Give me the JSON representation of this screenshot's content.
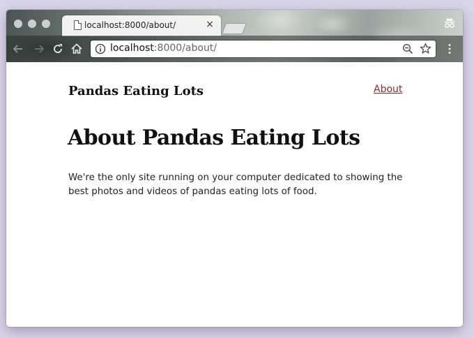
{
  "browser": {
    "tab": {
      "title": "localhost:8000/about/",
      "close_glyph": "×",
      "icon": "document-icon"
    },
    "omnibox": {
      "url_host": "localhost",
      "url_rest": ":8000/about/",
      "info_icon": "info-icon",
      "zoom_icon": "zoom-out-icon",
      "bookmark_icon": "star-icon"
    },
    "toolbar_icons": [
      "back-arrow-icon",
      "reload-icon",
      "home-icon",
      "kebab-menu-icon"
    ],
    "window_controls": [
      "close-dot",
      "minimize-dot",
      "maximize-dot"
    ]
  },
  "site": {
    "title": "Pandas Eating Lots",
    "nav": {
      "about_label": "About",
      "link_color": "#8a2a2a"
    }
  },
  "page": {
    "heading": "About Pandas Eating Lots",
    "body": "We're the only site running on your computer dedicated to showing the best photos and videos of pandas eating lots of food."
  }
}
